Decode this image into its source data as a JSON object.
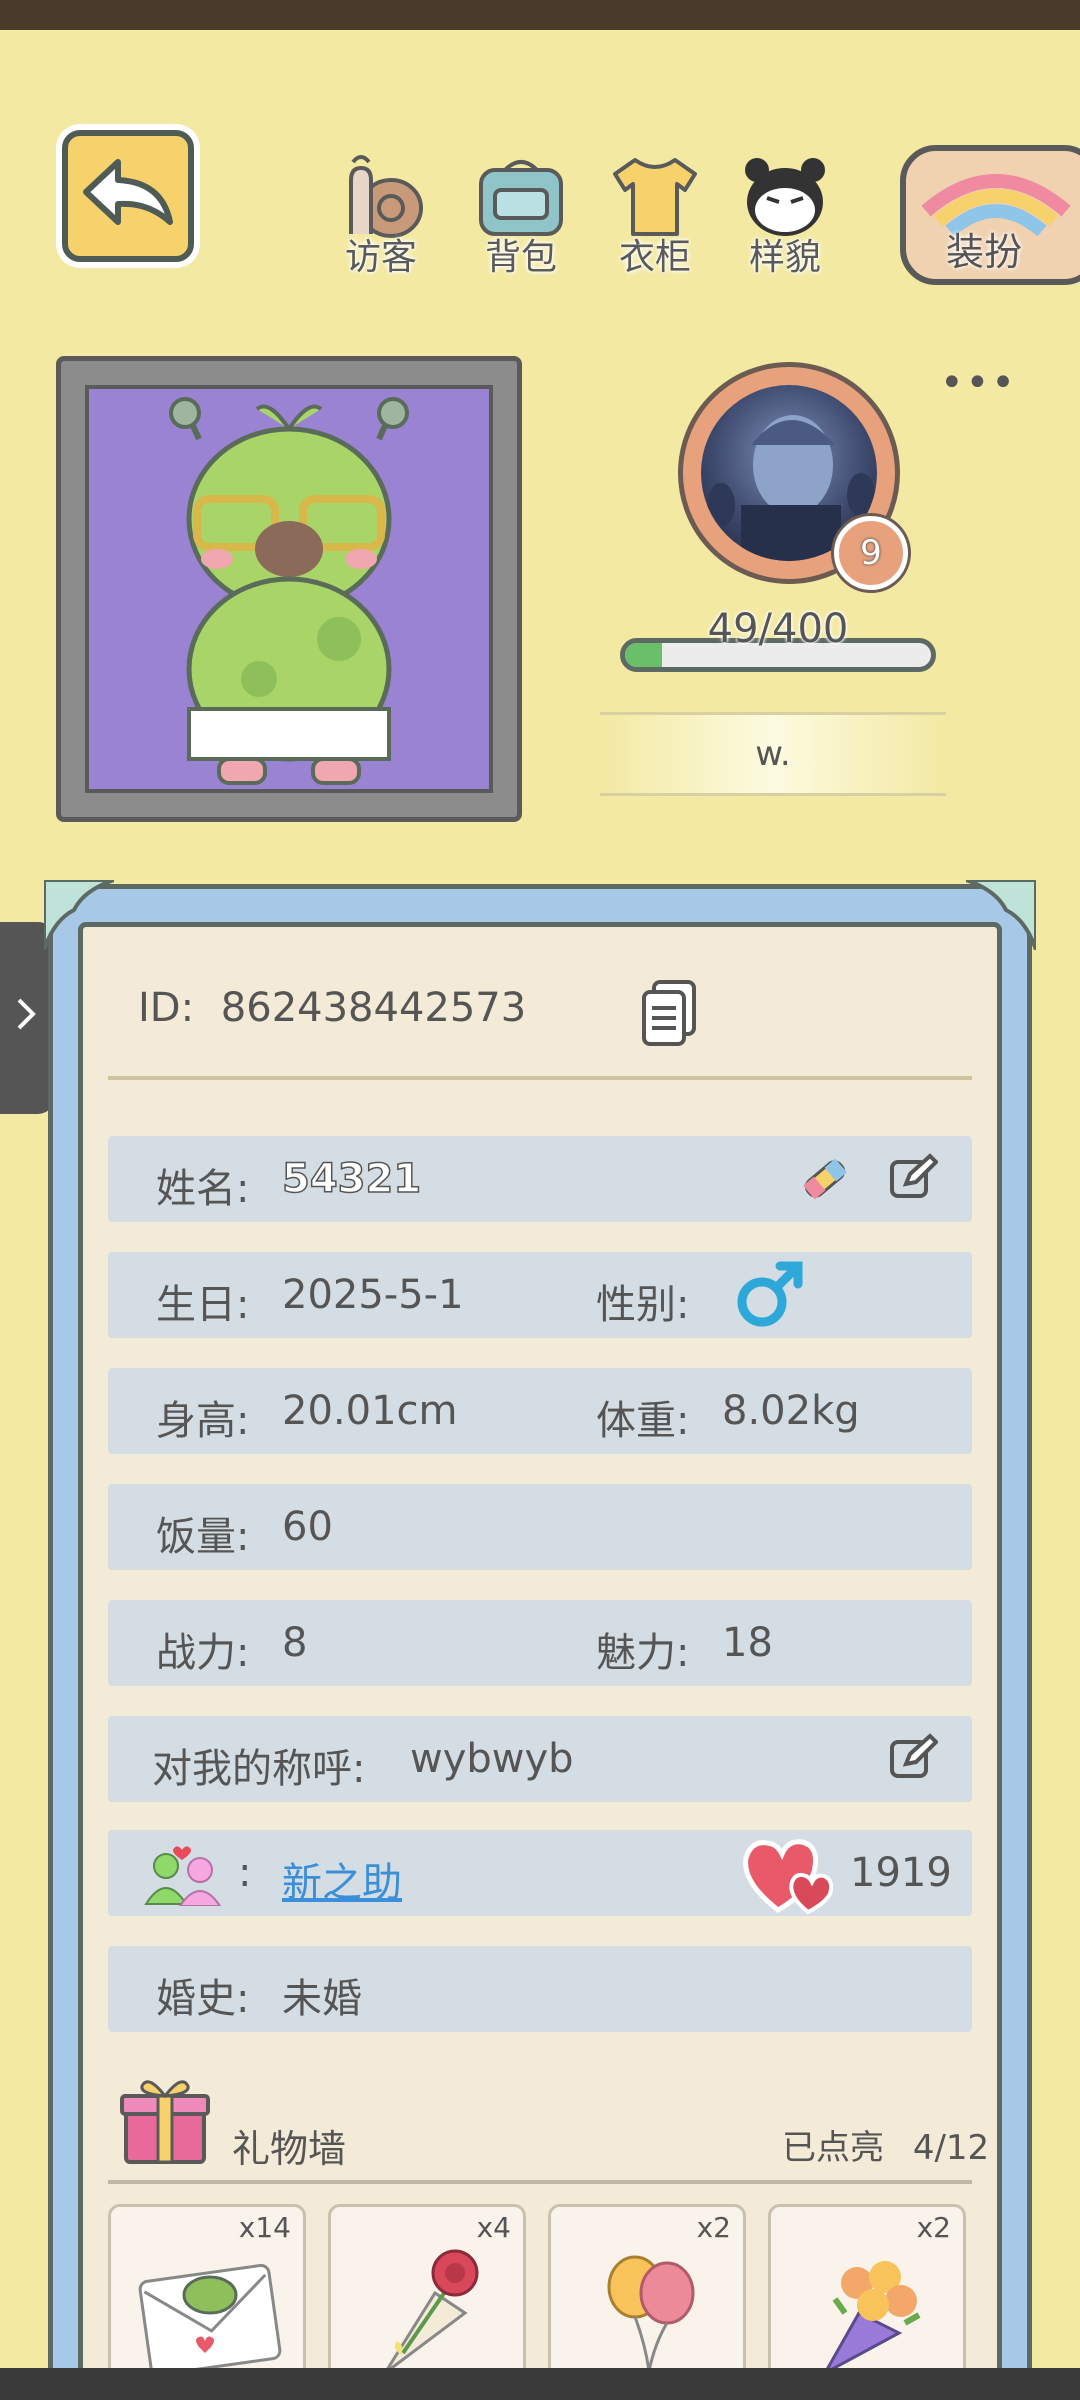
{
  "nav": {
    "visitors_label": "访客",
    "backpack_label": "背包",
    "wardrobe_label": "衣柜",
    "appearance_label": "样貌",
    "dress_up_label": "装扮"
  },
  "profile": {
    "level": "9",
    "xp_text": "49/400",
    "xp_progress": 0.1225,
    "nickname": "w."
  },
  "info": {
    "id_label": "ID:",
    "id_value": "862438442573",
    "name_label": "姓名:",
    "name_value": "54321",
    "birthday_label": "生日:",
    "birthday_value": "2025-5-1",
    "gender_label": "性别:",
    "height_label": "身高:",
    "height_value": "20.01cm",
    "weight_label": "体重:",
    "weight_value": "8.02kg",
    "appetite_label": "饭量:",
    "appetite_value": "60",
    "power_label": "战力:",
    "power_value": "8",
    "charm_label": "魅力:",
    "charm_value": "18",
    "callme_label": "对我的称呼:",
    "callme_value": "wybwyb",
    "spouse_sep": ":",
    "spouse_name": "新之助",
    "affection_value": "1919",
    "marriage_label": "婚史:",
    "marriage_value": "未婚"
  },
  "gifts": {
    "title": "礼物墙",
    "lit_label": "已点亮",
    "lit_count": "4/12",
    "items": [
      {
        "icon": "frog-letter-icon",
        "qty": "x14"
      },
      {
        "icon": "rose-bouquet-icon",
        "qty": "x4"
      },
      {
        "icon": "balloons-icon",
        "qty": "x2"
      },
      {
        "icon": "flower-bouquet-icon",
        "qty": "x2"
      }
    ]
  },
  "colors": {
    "background": "#f3e9a2",
    "panel_blue": "#a8c8e8",
    "row_bg": "#d4dde4",
    "accent_orange": "#e7a27d",
    "link_blue": "#3b8fd8",
    "male_icon": "#2ea8d8"
  }
}
